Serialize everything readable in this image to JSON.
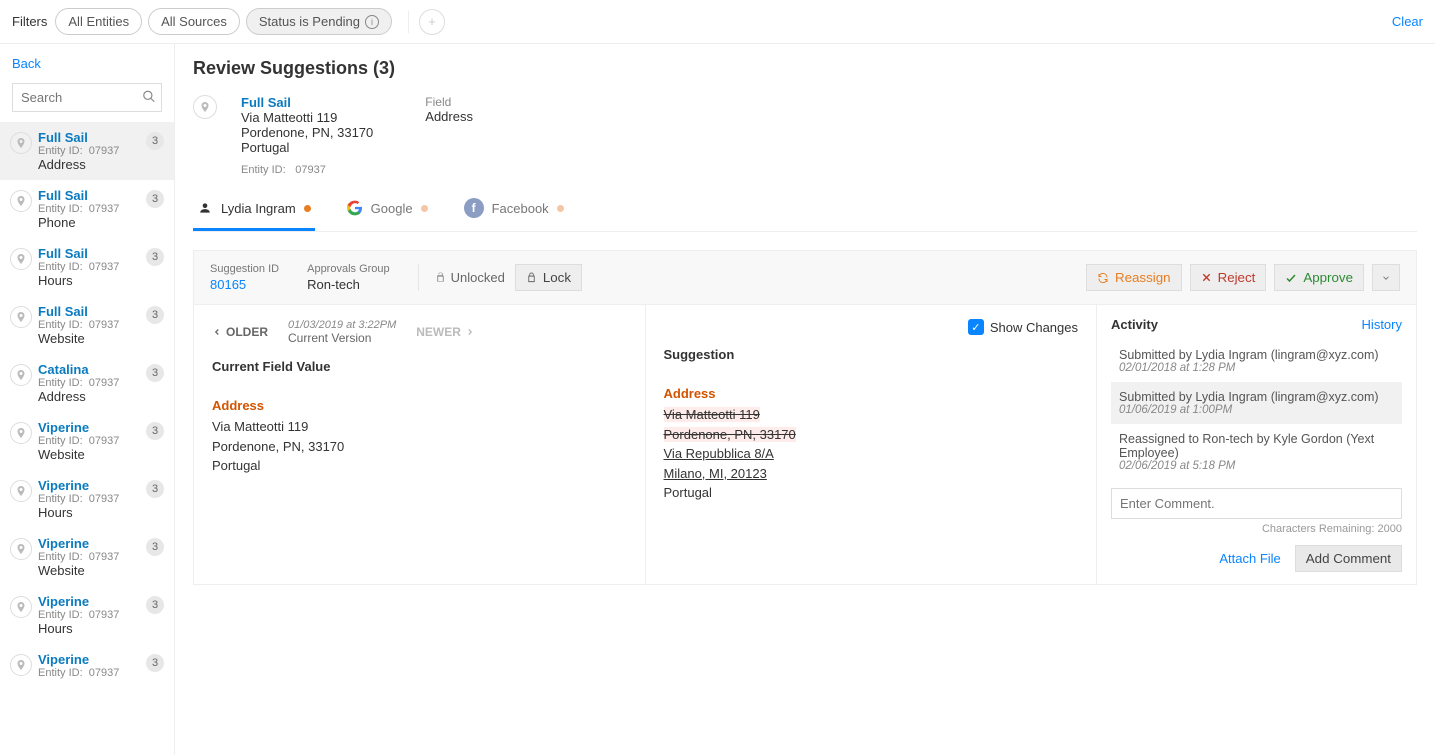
{
  "filters": {
    "label": "Filters",
    "pills": [
      {
        "label": "All Entities"
      },
      {
        "label": "All Sources"
      },
      {
        "label": "Status is Pending",
        "active": true
      }
    ],
    "clear": "Clear"
  },
  "sidebar": {
    "back": "Back",
    "search_placeholder": "Search",
    "items": [
      {
        "name": "Full Sail",
        "entity_id_label": "Entity ID:",
        "entity_id": "07937",
        "field": "Address",
        "count": "3",
        "selected": true
      },
      {
        "name": "Full Sail",
        "entity_id_label": "Entity ID:",
        "entity_id": "07937",
        "field": "Phone",
        "count": "3"
      },
      {
        "name": "Full Sail",
        "entity_id_label": "Entity ID:",
        "entity_id": "07937",
        "field": "Hours",
        "count": "3"
      },
      {
        "name": "Full Sail",
        "entity_id_label": "Entity ID:",
        "entity_id": "07937",
        "field": "Website",
        "count": "3"
      },
      {
        "name": "Catalina",
        "entity_id_label": "Entity ID:",
        "entity_id": "07937",
        "field": "Address",
        "count": "3"
      },
      {
        "name": "Viperine",
        "entity_id_label": "Entity ID:",
        "entity_id": "07937",
        "field": "Website",
        "count": "3"
      },
      {
        "name": "Viperine",
        "entity_id_label": "Entity ID:",
        "entity_id": "07937",
        "field": "Hours",
        "count": "3"
      },
      {
        "name": "Viperine",
        "entity_id_label": "Entity ID:",
        "entity_id": "07937",
        "field": "Website",
        "count": "3"
      },
      {
        "name": "Viperine",
        "entity_id_label": "Entity ID:",
        "entity_id": "07937",
        "field": "Hours",
        "count": "3"
      },
      {
        "name": "Viperine",
        "entity_id_label": "Entity ID:",
        "entity_id": "07937",
        "field": "",
        "count": "3"
      }
    ]
  },
  "title": "Review Suggestions (3)",
  "entity": {
    "name": "Full Sail",
    "address_lines": [
      "Via Matteotti 119",
      "Pordenone, PN, 33170",
      "Portugal"
    ],
    "entity_id_label": "Entity ID:",
    "entity_id": "07937",
    "field_label": "Field",
    "field_value": "Address"
  },
  "tabs": [
    {
      "label": "Lydia Ingram",
      "icon": "person",
      "active": true
    },
    {
      "label": "Google",
      "icon": "google"
    },
    {
      "label": "Facebook",
      "icon": "facebook"
    }
  ],
  "card": {
    "suggestion_id_label": "Suggestion ID",
    "suggestion_id": "80165",
    "approvals_group_label": "Approvals Group",
    "approvals_group": "Ron-tech",
    "lock_status": "Unlocked",
    "lock_button": "Lock",
    "actions": {
      "reassign": "Reassign",
      "reject": "Reject",
      "approve": "Approve"
    }
  },
  "left": {
    "older": "OLDER",
    "version_date": "01/03/2019 at 3:22PM",
    "version_label": "Current Version",
    "newer": "NEWER",
    "section_title": "Current Field Value",
    "field_label": "Address",
    "lines": [
      "Via Matteotti 119",
      "Pordenone, PN, 33170",
      "Portugal"
    ]
  },
  "right": {
    "show_changes": "Show Changes",
    "section_title": "Suggestion",
    "field_label": "Address",
    "lines": [
      {
        "text": "Via Matteotti 119",
        "kind": "strike"
      },
      {
        "text": "Pordenone, PN, 33170",
        "kind": "strike"
      },
      {
        "text": "Via Repubblica 8/A",
        "kind": "added"
      },
      {
        "text": "Milano, MI, 20123",
        "kind": "added"
      },
      {
        "text": "Portugal",
        "kind": "plain"
      }
    ]
  },
  "activity": {
    "title": "Activity",
    "history": "History",
    "items": [
      {
        "who": "Submitted by Lydia Ingram (lingram@xyz.com)",
        "when": "02/01/2018 at 1:28 PM"
      },
      {
        "who": "Submitted by Lydia Ingram (lingram@xyz.com)",
        "when": "01/06/2019 at 1:00PM",
        "highlight": true
      },
      {
        "who": "Reassigned to Ron-tech by Kyle Gordon (Yext Employee)",
        "when": "02/06/2019 at 5:18 PM"
      }
    ],
    "comment_placeholder": "Enter Comment.",
    "chars_remaining": "Characters Remaining: 2000",
    "attach": "Attach File",
    "add_comment": "Add Comment"
  }
}
